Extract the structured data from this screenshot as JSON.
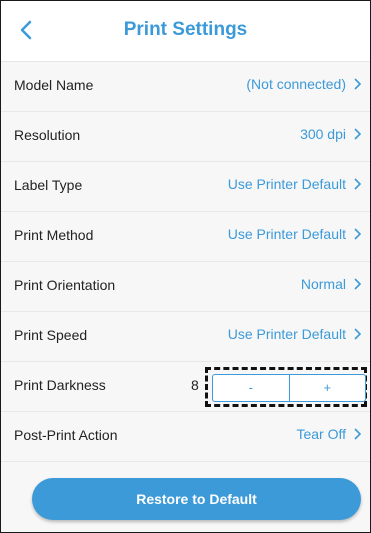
{
  "colors": {
    "accent": "#3c9ad8",
    "text": "#222222",
    "background": "#f7f7f7"
  },
  "header": {
    "title": "Print Settings",
    "back_icon": "chevron-left-icon"
  },
  "settings": {
    "model_name": {
      "label": "Model Name",
      "value": "(Not connected)"
    },
    "resolution": {
      "label": "Resolution",
      "value": "300 dpi"
    },
    "label_type": {
      "label": "Label Type",
      "value": "Use Printer Default"
    },
    "print_method": {
      "label": "Print Method",
      "value": "Use Printer Default"
    },
    "print_orientation": {
      "label": "Print Orientation",
      "value": "Normal"
    },
    "print_speed": {
      "label": "Print Speed",
      "value": "Use Printer Default"
    },
    "print_darkness": {
      "label": "Print Darkness",
      "value": "8",
      "decrement_label": "-",
      "increment_label": "+"
    },
    "post_print_action": {
      "label": "Post-Print Action",
      "value": "Tear Off"
    }
  },
  "footer": {
    "restore_label": "Restore to Default"
  }
}
